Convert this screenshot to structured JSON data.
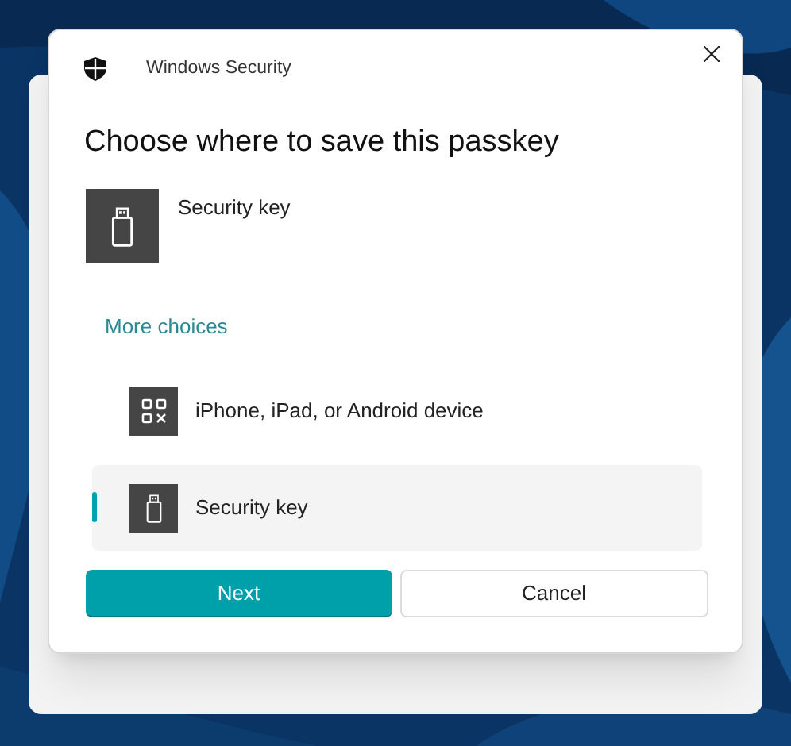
{
  "dialog": {
    "title": "Windows Security",
    "heading": "Choose where to save this passkey",
    "current": {
      "kind": "security_key",
      "label": "Security key"
    },
    "more_choices": "More choices",
    "options": [
      {
        "kind": "qr_code",
        "label": "iPhone, iPad, or Android device",
        "selected": false
      },
      {
        "kind": "security_key",
        "label": "Security key",
        "selected": true
      }
    ],
    "buttons": [
      {
        "label": "Next",
        "kind": "primary"
      },
      {
        "label": "Cancel",
        "kind": "secondary"
      }
    ]
  }
}
